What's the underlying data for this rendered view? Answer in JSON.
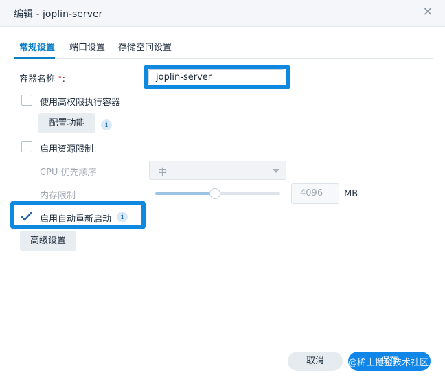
{
  "window": {
    "title": "编辑 - joplin-server",
    "close_glyph": "✕"
  },
  "tabs": [
    {
      "label": "常规设置",
      "active": true
    },
    {
      "label": "端口设置",
      "active": false
    },
    {
      "label": "存储空间设置",
      "active": false
    }
  ],
  "form": {
    "container_name_label": "容器名称",
    "required_mark": "*",
    "colon": ":",
    "container_name_value": "joplin-server",
    "privileged_label": "使用高权限执行容器",
    "privileged_checked": false,
    "configure_button": "配置功能",
    "resource_limit_label": "启用资源限制",
    "resource_limit_checked": false,
    "cpu_priority_label": "CPU 优先顺序",
    "cpu_priority_value": "中",
    "memory_limit_label": "内存限制",
    "memory_slider_fraction": 0.48,
    "memory_value": "4096",
    "memory_unit": "MB",
    "auto_restart_label": "启用自动重新启动",
    "auto_restart_checked": true,
    "advanced_button": "高级设置",
    "info_glyph": "i"
  },
  "footer": {
    "cancel_button": "取消",
    "save_button": "保存",
    "watermark": "@稀土掘金技术社区"
  },
  "colors": {
    "accent": "#0d7fc7",
    "highlight": "#0f88e0",
    "save": "#1086e8",
    "required": "#e64a4a"
  }
}
